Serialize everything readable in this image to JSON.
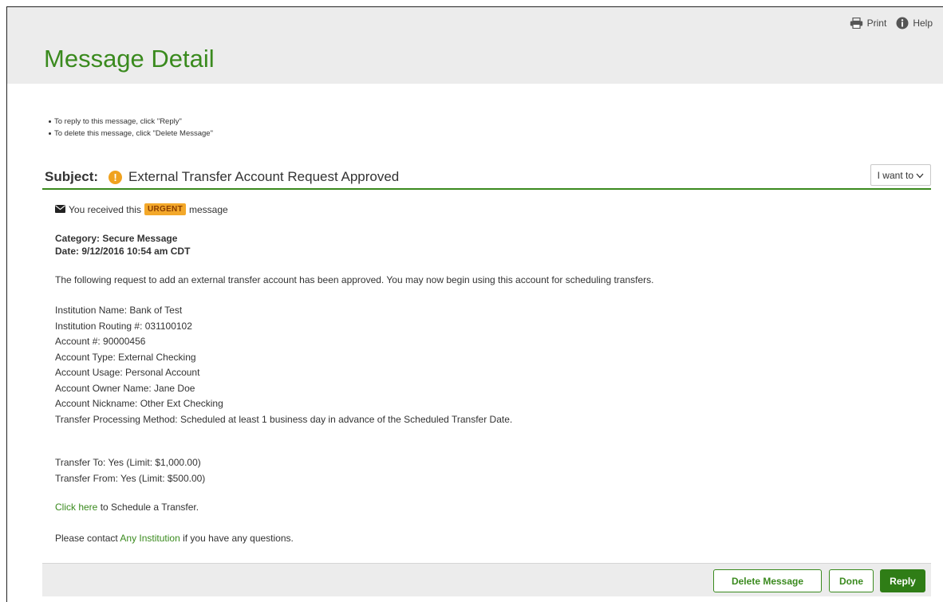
{
  "header": {
    "title": "Message Detail",
    "print_label": "Print",
    "help_label": "Help"
  },
  "instructions": [
    "To reply to this message, click \"Reply\"",
    "To delete this message, click \"Delete Message\""
  ],
  "subject": {
    "label": "Subject:",
    "urgent_icon": "!",
    "text": "External Transfer Account Request Approved",
    "i_want_to": "I want to"
  },
  "message": {
    "received_prefix": "You received this",
    "urgent_badge": "URGENT",
    "received_suffix": "message",
    "category": "Category: Secure Message",
    "date": "Date: 9/12/2016 10:54 am CDT",
    "intro": "The following request to add an external transfer account has been approved. You may now begin using this account for scheduling transfers.",
    "details": [
      "Institution Name: Bank of Test",
      "Institution Routing #: 031100102",
      "Account #: 90000456",
      "Account Type: External Checking",
      "Account Usage: Personal Account",
      "Account Owner Name: Jane Doe",
      "Account Nickname: Other Ext Checking",
      "Transfer Processing Method: Scheduled at least 1 business day in advance of the Scheduled Transfer Date."
    ],
    "limits": [
      "Transfer To: Yes (Limit: $1,000.00)",
      "Transfer From: Yes (Limit: $500.00)"
    ],
    "click_link": "Click here",
    "click_suffix": " to Schedule a Transfer.",
    "contact_prefix": "Please contact ",
    "contact_link": "Any Institution",
    "contact_suffix": " if you have any questions."
  },
  "footer": {
    "delete_label": "Delete Message",
    "done_label": "Done",
    "reply_label": "Reply"
  },
  "colors": {
    "accent": "#3a8a1e",
    "primary_button": "#2f7d16",
    "urgent": "#f3a82a",
    "band": "#ececec"
  },
  "icons": [
    "printer-icon",
    "help-icon",
    "warning-icon",
    "chevron-down-icon",
    "envelope-icon"
  ]
}
